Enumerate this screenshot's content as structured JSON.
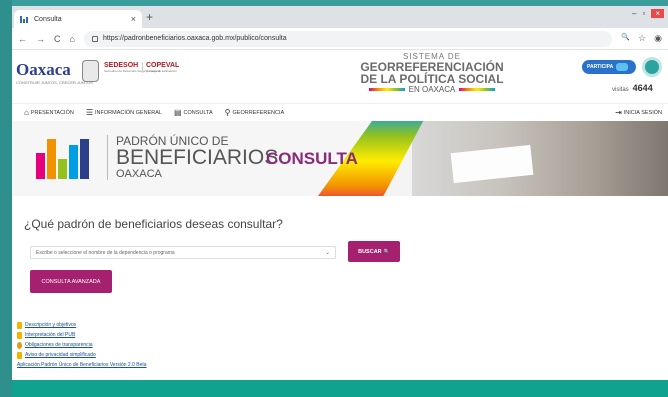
{
  "browser": {
    "tab_title": "Consulta",
    "tab_close": "×",
    "new_tab": "+",
    "url": "https://padronbeneficiarios.oaxaca.gob.mx/publico/consulta",
    "nav_back": "←",
    "nav_forward": "→",
    "nav_reload": "C",
    "nav_home": "⌂",
    "win_min": "–",
    "win_max": "▫",
    "win_close": "×",
    "zoom_icon": "🔍",
    "star_icon": "☆",
    "profile_icon": "◉"
  },
  "header": {
    "oaxaca_logo": "Oaxaca",
    "oaxaca_sub": "CONSTRUIR JUNTOS, CRECER JUNTOS",
    "sedesoh": "SEDESOH",
    "sedesoh_sub": "Secretaría de Desarrollo Social y Humano",
    "coepeval": "COPEVAL",
    "coepeval_sub": "Consejo de Evaluación",
    "georef_line1": "SISTEMA DE",
    "georef_line2": "GEORREFERENCIACIÓN",
    "georef_line3": "DE LA POLÍTICA SOCIAL",
    "georef_line4": "EN OAXACA",
    "participa": "PARTICIPA",
    "visitas_label": "visitas",
    "visitas_count": "4644"
  },
  "nav": {
    "items": [
      {
        "label": "PRESENTACIÓN",
        "icon": "⌂"
      },
      {
        "label": "INFORMACIÓN GENERAL",
        "icon": "☰"
      },
      {
        "label": "CONSULTA",
        "icon": "▤"
      },
      {
        "label": "GEORREFERENCIA",
        "icon": "⚲"
      }
    ],
    "login": "INICIA SESIÓN",
    "login_icon": "⇥"
  },
  "banner": {
    "line1": "PADRÓN ÚNICO DE",
    "line2": "BENEFICIARIOS",
    "line3": "OAXACA",
    "consulta": "CONSULTA"
  },
  "main": {
    "question": "¿Qué padrón de beneficiarios deseas consultar?",
    "select_placeholder": "Escribe o seleccione el nombre de la dependencia o programa",
    "select_chevron": "⌄",
    "buscar": "BUSCAR",
    "buscar_icon": "🔍",
    "consulta_avanzada": "CONSULTA AVANZADA"
  },
  "links": [
    "Descripción y objetivos",
    "Interpretación del PUB",
    "Obligaciones de transparencia",
    "Aviso de privacidad simplificado",
    "Aplicación Padrón Único de Beneficiarios Versión 2.0 Beta"
  ],
  "colors": {
    "accent": "#a5216f",
    "teal": "#11a18f",
    "brand_blue": "#2b3f8c"
  }
}
